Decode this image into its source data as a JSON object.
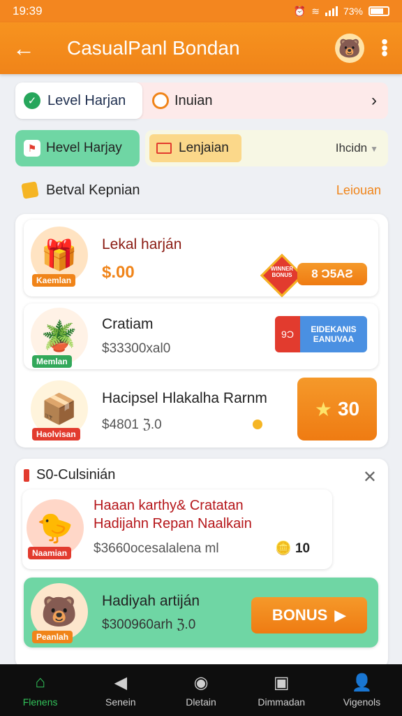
{
  "status_bar": {
    "time": "19:39",
    "battery": "73%"
  },
  "header": {
    "title": "CasualPanl Bondan",
    "back_icon": "back-arrow-icon",
    "menu_icon": "more-vert-icon"
  },
  "tabs_row1": {
    "active_label": "Level Harjan",
    "second_label": "Inuian"
  },
  "tabs_row2": {
    "green_label": "Hevel Harjay",
    "cream_label": "Lenjaian",
    "dropdown_label": "Ihcidn"
  },
  "section1": {
    "title": "Betval Kepnian",
    "link": "Leiouan",
    "items": [
      {
        "title": "Lekal harján",
        "subtitle": "$.00",
        "badge": "Kaemlan",
        "action": "8 Ɔ5AƧ",
        "seal_text": "WINNER BONUS"
      },
      {
        "title": "Cratiam",
        "subtitle": "$33300xal0",
        "badge": "Memlan",
        "btn_left": "9Ɔ",
        "btn_right_top": "EIDEKANIS",
        "btn_right_bottom": "EANUVAA"
      },
      {
        "title": "Hacipsel Hlakalha Rarnm",
        "subtitle": "$4801 ℨ.0",
        "badge": "Haolvisan",
        "action": "30"
      }
    ]
  },
  "section2": {
    "title": "S0-Culsinián",
    "items": [
      {
        "title_line1": "Haaan karthy& Cratatan",
        "title_line2": "Hadijahn Repan Naalkain",
        "subtitle": "$3660ocesalalena ml",
        "badge": "Naamian",
        "reward": "10"
      },
      {
        "title": "Hadiyah artiján",
        "subtitle": "$300960arh ℨ.0",
        "badge": "Peanlah",
        "action": "BONUS"
      }
    ]
  },
  "bottom_nav": [
    {
      "label": "Flenens",
      "icon": "home-icon",
      "active": true
    },
    {
      "label": "Senein",
      "icon": "megaphone-icon",
      "active": false
    },
    {
      "label": "Dletain",
      "icon": "upload-circle-icon",
      "active": false
    },
    {
      "label": "Dimmadan",
      "icon": "square-box-icon",
      "active": false
    },
    {
      "label": "Vigenols",
      "icon": "profile-icon",
      "active": false
    }
  ],
  "colors": {
    "brand_orange": "#f08419",
    "green": "#32c25a",
    "red": "#e23b2e"
  }
}
